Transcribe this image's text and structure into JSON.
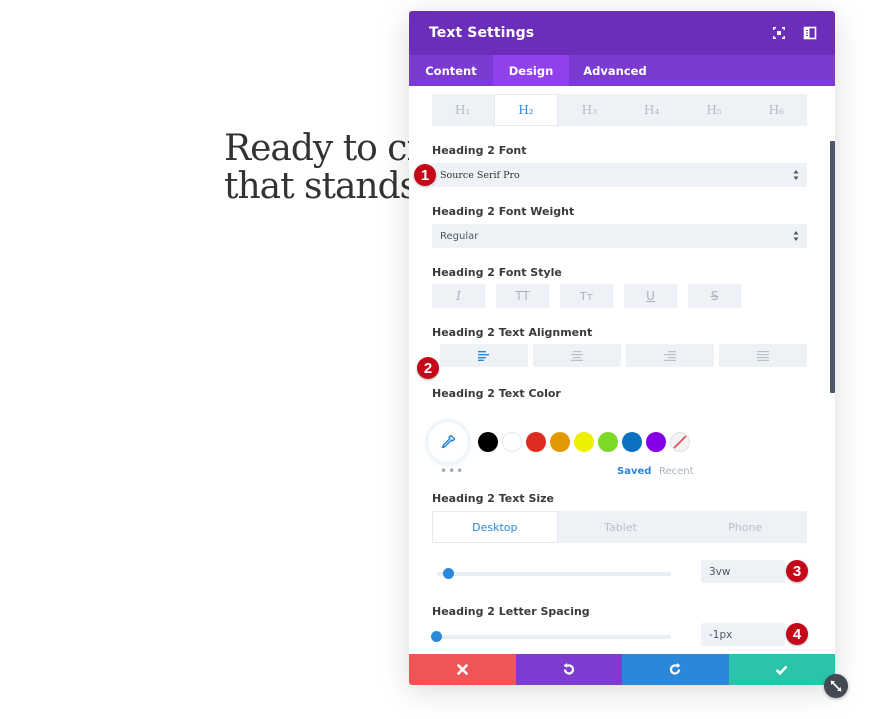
{
  "page": {
    "heading_lines": [
      "Ready to cre",
      "that stands"
    ]
  },
  "modal": {
    "title": "Text Settings",
    "header_icons": [
      "focus-icon",
      "sidebar-toggle-icon"
    ],
    "tabs": [
      {
        "label": "Content",
        "active": false
      },
      {
        "label": "Design",
        "active": true
      },
      {
        "label": "Advanced",
        "active": false
      }
    ]
  },
  "heading_tabs": [
    {
      "label": "H₁",
      "active": false
    },
    {
      "label": "H₂",
      "active": true
    },
    {
      "label": "H₃",
      "active": false
    },
    {
      "label": "H₄",
      "active": false
    },
    {
      "label": "H₅",
      "active": false
    },
    {
      "label": "H₆",
      "active": false
    }
  ],
  "font": {
    "label": "Heading 2 Font",
    "value": "Source Serif Pro",
    "badge": "1"
  },
  "font_weight": {
    "label": "Heading 2 Font Weight",
    "value": "Regular"
  },
  "font_style": {
    "label": "Heading 2 Font Style",
    "buttons": [
      {
        "name": "italic",
        "glyph": "I"
      },
      {
        "name": "uppercase",
        "glyph": "TT"
      },
      {
        "name": "capitalize",
        "glyph": "Tᴛ"
      },
      {
        "name": "underline",
        "glyph": "U"
      },
      {
        "name": "strikethrough",
        "glyph": "S"
      }
    ]
  },
  "text_alignment": {
    "label": "Heading 2 Text Alignment",
    "badge": "2",
    "options": [
      "left",
      "center",
      "right",
      "justify"
    ],
    "selected": "left"
  },
  "text_color": {
    "label": "Heading 2 Text Color",
    "swatches": [
      "#000000",
      "#ffffff",
      "#e02b20",
      "#e09900",
      "#edf000",
      "#7cda24",
      "#0c71c3",
      "#8300e9"
    ],
    "clear_label": "none",
    "palette_tabs": [
      {
        "label": "Saved",
        "active": true
      },
      {
        "label": "Recent",
        "active": false
      }
    ],
    "more": "•••"
  },
  "text_size": {
    "label": "Heading 2 Text Size",
    "devices": [
      {
        "label": "Desktop",
        "active": true
      },
      {
        "label": "Tablet",
        "active": false
      },
      {
        "label": "Phone",
        "active": false
      }
    ],
    "value": "3vw",
    "slider_fraction": 0.03,
    "badge": "3"
  },
  "letter_spacing": {
    "label": "Heading 2 Letter Spacing",
    "value": "-1px",
    "slider_fraction": 0.0,
    "badge": "4"
  },
  "footer": {
    "buttons": [
      {
        "name": "cancel",
        "color": "#ef5555"
      },
      {
        "name": "undo",
        "color": "#7e3bd0"
      },
      {
        "name": "redo",
        "color": "#2b87da"
      },
      {
        "name": "save",
        "color": "#29c4a9"
      }
    ]
  },
  "colors": {
    "header_bg": "#6c2eb9",
    "tabs_bg": "#7b3ad0",
    "active_tab_bg": "#8f42ec",
    "accent_blue": "#2b87da",
    "badge_red": "#c4081a"
  }
}
